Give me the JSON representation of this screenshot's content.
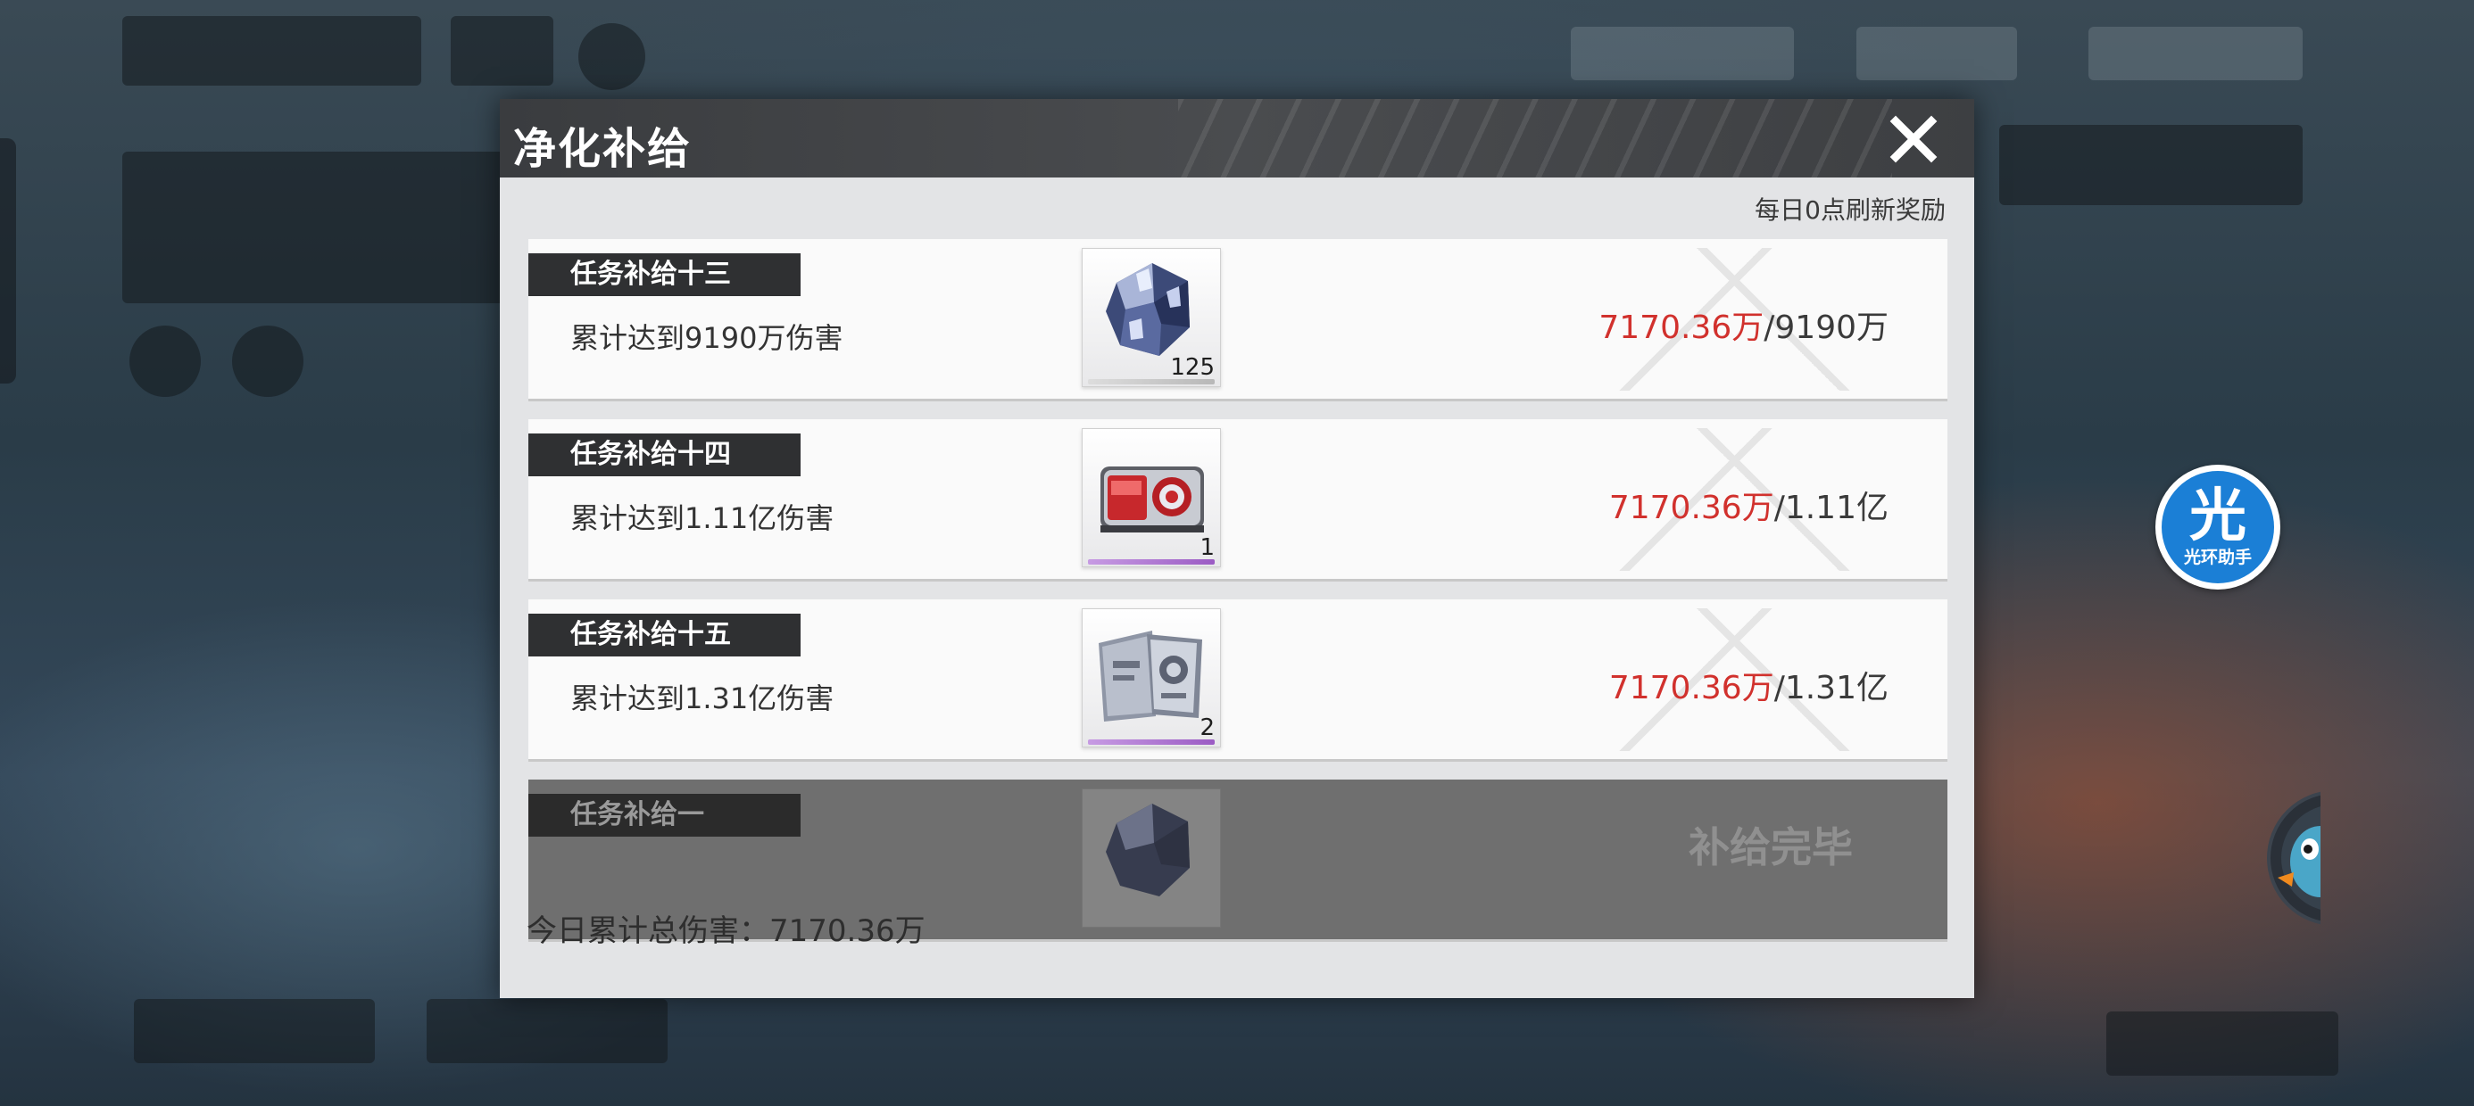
{
  "dialog": {
    "title": "净化补给",
    "refresh_note": "每日0点刷新奖励"
  },
  "tasks": [
    {
      "tag": "任务补给十三",
      "desc": "累计达到9190万伤害",
      "reward_icon": "crystal-ore-icon",
      "reward_count": "125",
      "progress_current": "7170.36万",
      "progress_target": "/9190万",
      "rarity_color": "#b8b8b8"
    },
    {
      "tag": "任务补给十四",
      "desc": "累计达到1.11亿伤害",
      "reward_icon": "red-device-icon",
      "reward_count": "1",
      "progress_current": "7170.36万",
      "progress_target": "/1.11亿",
      "rarity_color": "#9b5bc4"
    },
    {
      "tag": "任务补给十五",
      "desc": "累计达到1.31亿伤害",
      "reward_icon": "document-stack-icon",
      "reward_count": "2",
      "progress_current": "7170.36万",
      "progress_target": "/1.31亿",
      "rarity_color": "#9b5bc4"
    },
    {
      "tag": "任务补给一",
      "reward_icon": "crystal-ore-icon",
      "status": "补给完毕"
    }
  ],
  "total_damage": "今日累计总伤害：7170.36万",
  "helper": {
    "glyph": "光",
    "label": "光环助手"
  },
  "colors": {
    "progress_red": "#d1312d",
    "header_dark": "#3a3c3f",
    "tag_dark": "#2f3032",
    "helper_blue": "#1b7fd6"
  }
}
